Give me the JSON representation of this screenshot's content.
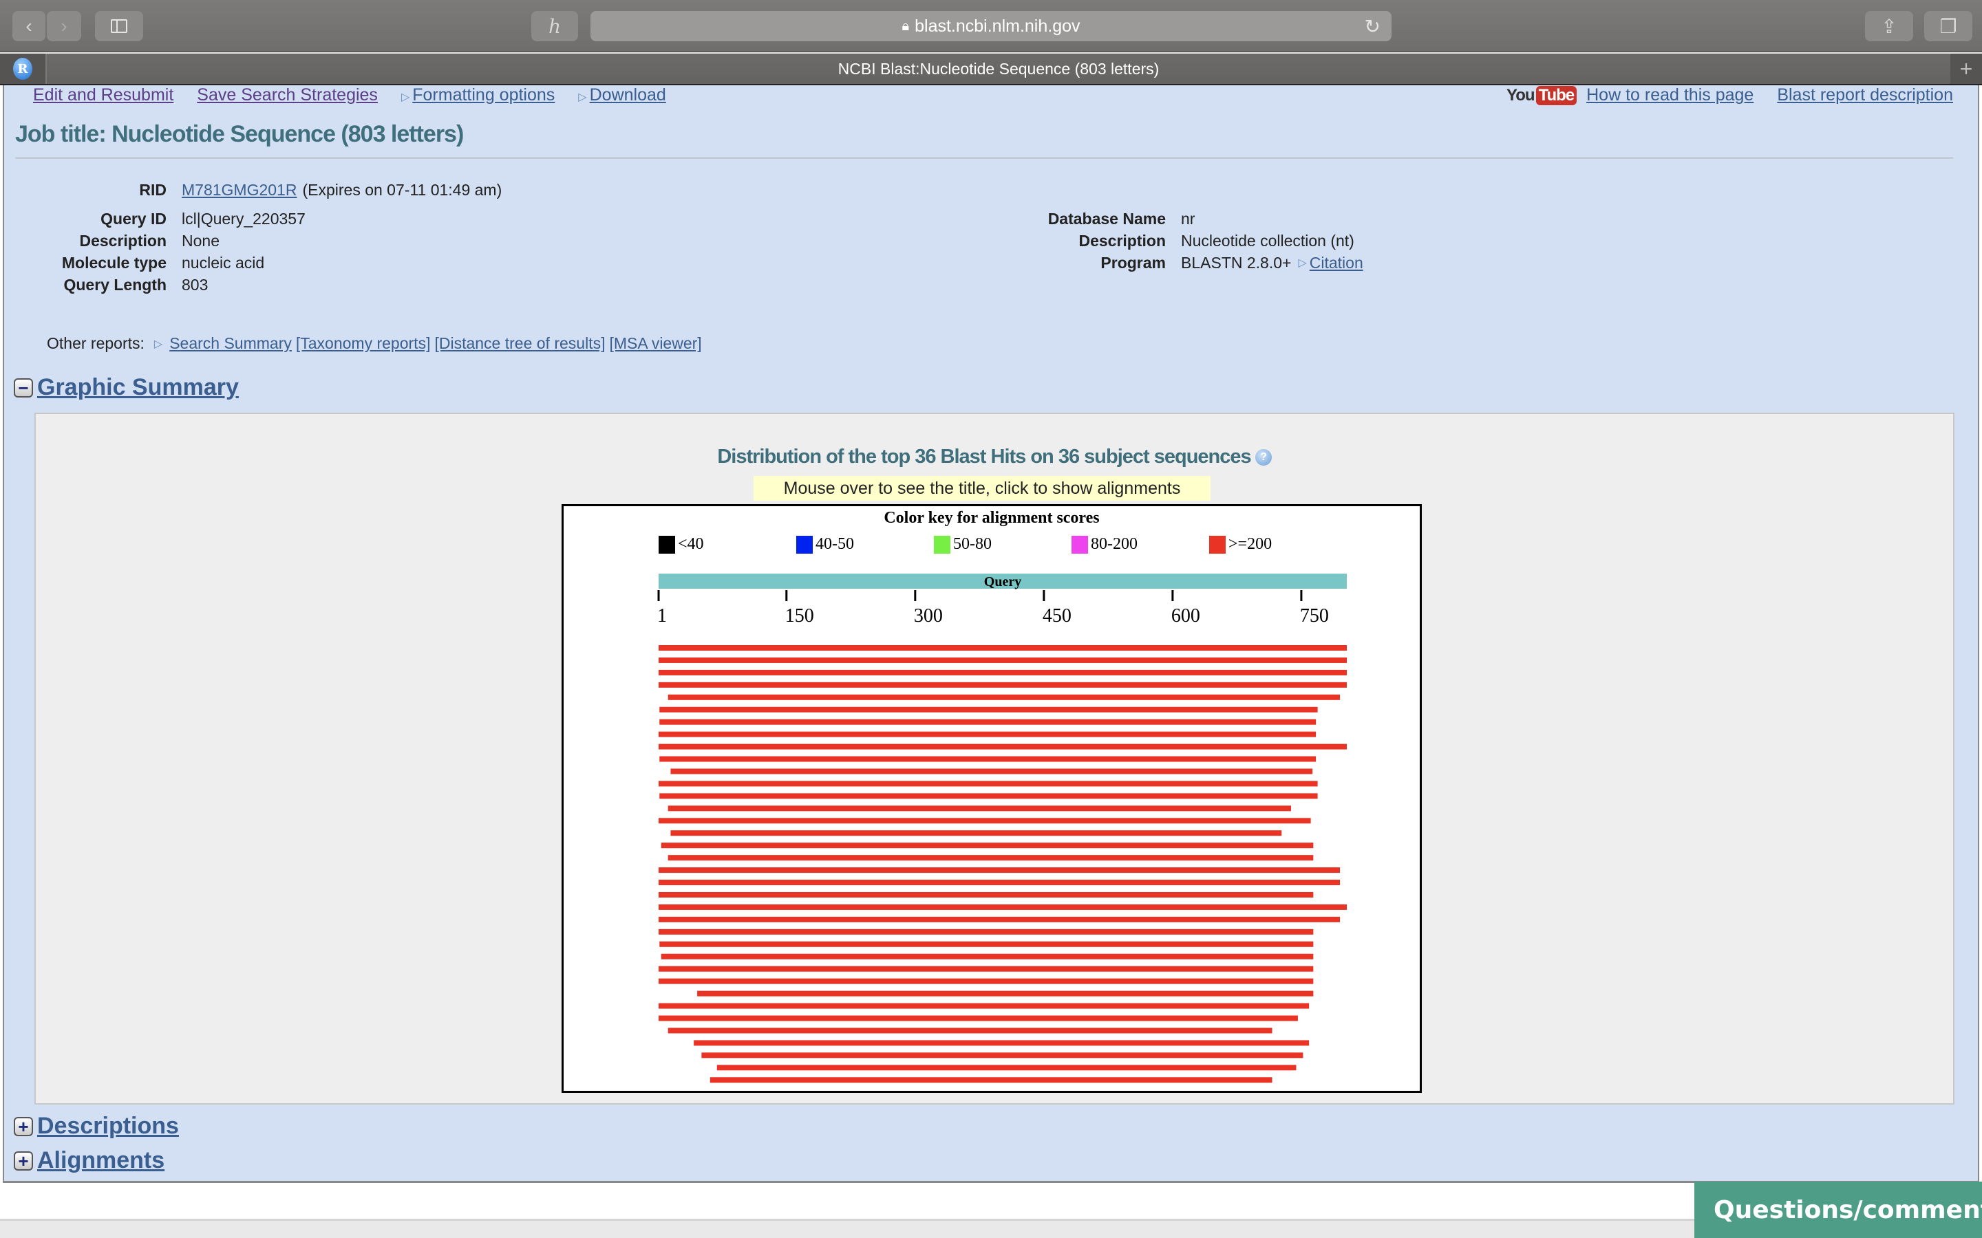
{
  "browser": {
    "url": "blast.ncbi.nlm.nih.gov",
    "tab_title": "NCBI Blast:Nucleotide Sequence (803 letters)",
    "favicon_letter": "R",
    "icons": {
      "back": "chevron-left-icon",
      "forward": "chevron-right-icon",
      "sidebar": "sidebar-icon",
      "extension": "extension-icon",
      "lock": "lock-icon",
      "reload": "reload-icon",
      "share": "share-icon",
      "tabs": "tabs-icon",
      "new_tab": "plus-icon"
    }
  },
  "toplinks": {
    "edit_resubmit": "Edit and Resubmit",
    "save_strategies": "Save Search Strategies",
    "formatting_options": "Formatting options",
    "download": "Download",
    "youtube_you": "You",
    "youtube_tube": "Tube",
    "how_to_read": "How to read this page",
    "report_description": "Blast report description"
  },
  "job_title": "Job title: Nucleotide Sequence (803 letters)",
  "summary": {
    "rid_label": "RID",
    "rid_value": "M781GMG201R",
    "rid_expiry": "(Expires on 07-11 01:49 am)",
    "left": [
      {
        "label": "Query ID",
        "value": "lcl|Query_220357"
      },
      {
        "label": "Description",
        "value": "None"
      },
      {
        "label": "Molecule type",
        "value": "nucleic acid"
      },
      {
        "label": "Query Length",
        "value": "803"
      }
    ],
    "right": [
      {
        "label": "Database Name",
        "value": "nr"
      },
      {
        "label": "Description",
        "value": "Nucleotide collection (nt)"
      },
      {
        "label": "Program",
        "value": "BLASTN 2.8.0+",
        "link": "Citation"
      }
    ]
  },
  "other_reports": {
    "label": "Other reports:",
    "links": [
      "Search Summary",
      "[Taxonomy reports]",
      "[Distance tree of results]",
      "[MSA viewer]"
    ]
  },
  "sections": {
    "graphic_summary": "Graphic Summary",
    "descriptions": "Descriptions",
    "alignments": "Alignments"
  },
  "graphic": {
    "title": "Distribution of the top 36 Blast Hits on 36 subject sequences",
    "hint": "Mouse over to see the title, click to show alignments"
  },
  "chart_data": {
    "type": "bar",
    "orientation": "horizontal-range",
    "title": "Color key for alignment scores",
    "query_label": "Query",
    "query_length": 803,
    "xlim": [
      1,
      803
    ],
    "ticks": [
      1,
      150,
      300,
      450,
      600,
      750
    ],
    "legend": [
      {
        "label": "<40",
        "color": "#000000"
      },
      {
        "label": "40-50",
        "color": "#0022ee"
      },
      {
        "label": "50-80",
        "color": "#77ee44"
      },
      {
        "label": "80-200",
        "color": "#ee44ee"
      },
      {
        "label": ">=200",
        "color": "#e83325"
      }
    ],
    "hits": [
      {
        "start": 1,
        "end": 803,
        "score": ">=200"
      },
      {
        "start": 1,
        "end": 803,
        "score": ">=200"
      },
      {
        "start": 1,
        "end": 803,
        "score": ">=200"
      },
      {
        "start": 1,
        "end": 803,
        "score": ">=200"
      },
      {
        "start": 12,
        "end": 795,
        "score": ">=200"
      },
      {
        "start": 2,
        "end": 769,
        "score": ">=200"
      },
      {
        "start": 2,
        "end": 767,
        "score": ">=200"
      },
      {
        "start": 1,
        "end": 767,
        "score": ">=200"
      },
      {
        "start": 1,
        "end": 803,
        "score": ">=200"
      },
      {
        "start": 2,
        "end": 767,
        "score": ">=200"
      },
      {
        "start": 15,
        "end": 763,
        "score": ">=200"
      },
      {
        "start": 1,
        "end": 769,
        "score": ">=200"
      },
      {
        "start": 2,
        "end": 769,
        "score": ">=200"
      },
      {
        "start": 12,
        "end": 738,
        "score": ">=200"
      },
      {
        "start": 1,
        "end": 761,
        "score": ">=200"
      },
      {
        "start": 15,
        "end": 727,
        "score": ">=200"
      },
      {
        "start": 4,
        "end": 764,
        "score": ">=200"
      },
      {
        "start": 12,
        "end": 764,
        "score": ">=200"
      },
      {
        "start": 1,
        "end": 795,
        "score": ">=200"
      },
      {
        "start": 1,
        "end": 795,
        "score": ">=200"
      },
      {
        "start": 1,
        "end": 764,
        "score": ">=200"
      },
      {
        "start": 1,
        "end": 803,
        "score": ">=200"
      },
      {
        "start": 1,
        "end": 795,
        "score": ">=200"
      },
      {
        "start": 1,
        "end": 764,
        "score": ">=200"
      },
      {
        "start": 2,
        "end": 764,
        "score": ">=200"
      },
      {
        "start": 4,
        "end": 764,
        "score": ">=200"
      },
      {
        "start": 1,
        "end": 764,
        "score": ">=200"
      },
      {
        "start": 1,
        "end": 764,
        "score": ">=200"
      },
      {
        "start": 46,
        "end": 764,
        "score": ">=200"
      },
      {
        "start": 1,
        "end": 759,
        "score": ">=200"
      },
      {
        "start": 1,
        "end": 746,
        "score": ">=200"
      },
      {
        "start": 12,
        "end": 716,
        "score": ">=200"
      },
      {
        "start": 42,
        "end": 759,
        "score": ">=200"
      },
      {
        "start": 51,
        "end": 752,
        "score": ">=200"
      },
      {
        "start": 69,
        "end": 744,
        "score": ">=200"
      },
      {
        "start": 61,
        "end": 716,
        "score": ">=200"
      }
    ],
    "colors": {
      "query_bar": "#7ac6c6",
      "hit": "#e83325"
    }
  },
  "feedback_button": "Questions/comments"
}
